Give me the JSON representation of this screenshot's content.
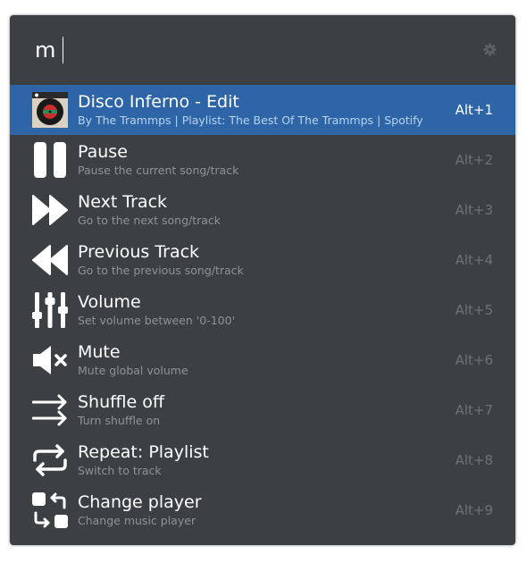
{
  "search": {
    "query": "m"
  },
  "colors": {
    "background": "#3c4042",
    "selected": "#2d65a6",
    "text": "#ffffff",
    "subtext": "#8e9396",
    "shortcut": "#6e7275"
  },
  "results": [
    {
      "icon": "album-art-icon",
      "title": "Disco Inferno - Edit",
      "subtitle": "By The Trammps | Playlist: The Best Of The Trammps | Spotify",
      "shortcut": "Alt+1",
      "selected": true
    },
    {
      "icon": "pause-icon",
      "title": "Pause",
      "subtitle": "Pause the current song/track",
      "shortcut": "Alt+2"
    },
    {
      "icon": "next-track-icon",
      "title": "Next Track",
      "subtitle": "Go to the next song/track",
      "shortcut": "Alt+3"
    },
    {
      "icon": "previous-track-icon",
      "title": "Previous Track",
      "subtitle": "Go to the previous song/track",
      "shortcut": "Alt+4"
    },
    {
      "icon": "volume-sliders-icon",
      "title": "Volume",
      "subtitle": "Set volume between '0-100'",
      "shortcut": "Alt+5"
    },
    {
      "icon": "mute-icon",
      "title": "Mute",
      "subtitle": "Mute global volume",
      "shortcut": "Alt+6"
    },
    {
      "icon": "shuffle-off-icon",
      "title": "Shuffle off",
      "subtitle": "Turn shuffle on",
      "shortcut": "Alt+7"
    },
    {
      "icon": "repeat-icon",
      "title": "Repeat: Playlist",
      "subtitle": "Switch to track",
      "shortcut": "Alt+8"
    },
    {
      "icon": "change-player-icon",
      "title": "Change player",
      "subtitle": "Change music player",
      "shortcut": "Alt+9"
    }
  ]
}
